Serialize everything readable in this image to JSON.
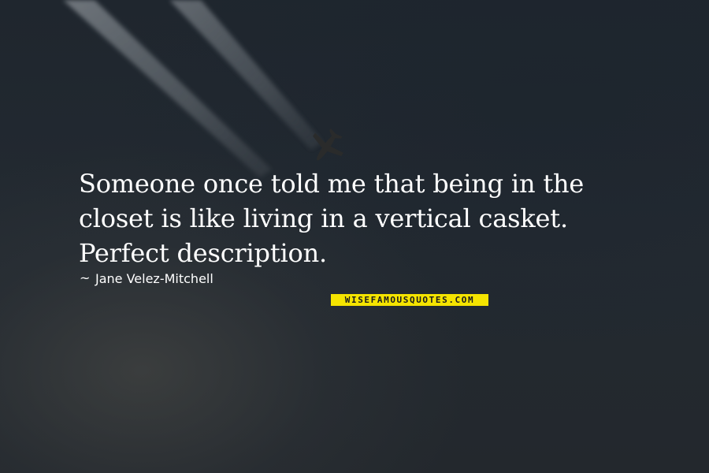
{
  "quote": {
    "lines": [
      "Someone once told me that being in the",
      "closet is like living in a vertical casket.",
      "Perfect description."
    ],
    "author": "Jane Velez-Mitchell",
    "author_prefix": "~"
  },
  "watermark": {
    "text": "WISEFAMOUSQUOTES.COM"
  },
  "colors": {
    "background": "#1e242b",
    "text": "#ffffff",
    "watermark_bg": "#f5e400"
  },
  "icons": {
    "airplane": "airplane-icon"
  }
}
